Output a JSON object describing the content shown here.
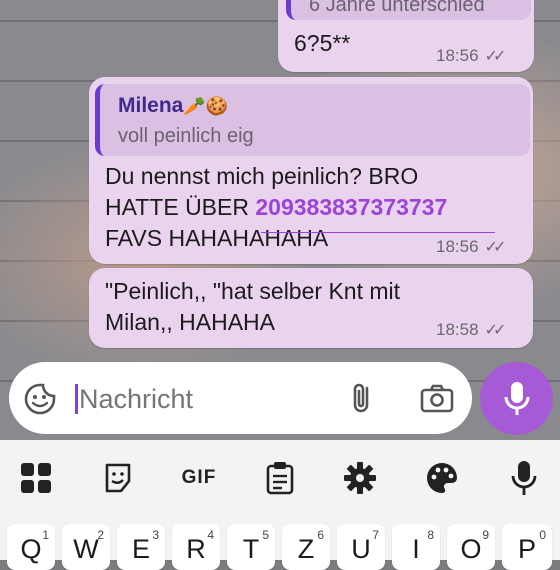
{
  "chat": {
    "messages": [
      {
        "quoted_partial": "6 Jahre unterschied",
        "text": "6?5**",
        "time": "18:56",
        "status_icon": "double-check-icon"
      },
      {
        "reply_to": {
          "name": "Milena",
          "emoji": "🥕🍪",
          "text": "voll peinlich eig"
        },
        "text_line1": "Du nennst mich peinlich? BRO",
        "text_line2_prefix": "HATTE ÜBER ",
        "text_line2_number": "209383837373737",
        "text_line3": "FAVS HAHAHAHAHA",
        "time": "18:56",
        "status_icon": "double-check-icon"
      },
      {
        "text_line1": "\"Peinlich,,  \"hat selber Knt mit",
        "text_line2": "Milan,, HAHAHA",
        "time": "18:58",
        "status_icon": "double-check-icon"
      }
    ]
  },
  "composer": {
    "placeholder": "Nachricht",
    "emoji_icon": "sticker-emoji-icon",
    "attach_icon": "paperclip-icon",
    "camera_icon": "camera-icon",
    "mic_icon": "microphone-icon",
    "accent": "#a65ad6"
  },
  "keyboard": {
    "toolbar": [
      "apps-grid-icon",
      "sticker-icon",
      "GIF",
      "clipboard-icon",
      "gear-icon",
      "palette-icon",
      "microphone-icon"
    ],
    "gif_label": "GIF",
    "keys": [
      {
        "char": "Q",
        "num": "1"
      },
      {
        "char": "W",
        "num": "2"
      },
      {
        "char": "E",
        "num": "3"
      },
      {
        "char": "R",
        "num": "4"
      },
      {
        "char": "T",
        "num": "5"
      },
      {
        "char": "Z",
        "num": "6"
      },
      {
        "char": "U",
        "num": "7"
      },
      {
        "char": "I",
        "num": "8"
      },
      {
        "char": "O",
        "num": "9"
      },
      {
        "char": "P",
        "num": "0"
      }
    ]
  }
}
